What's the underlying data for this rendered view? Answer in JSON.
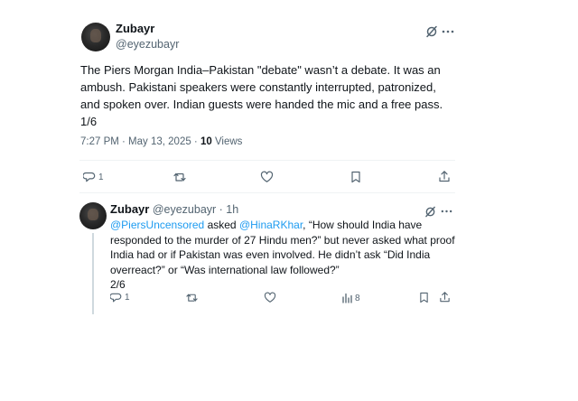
{
  "main_tweet": {
    "author_name": "Zubayr",
    "author_handle": "@eyezubayr",
    "text": "The Piers Morgan India–Pakistan \"debate\" wasn’t a debate. It was an ambush. Pakistani speakers were constantly interrupted, patronized, and spoken over. Indian guests were handed the mic and a free pass.\n1/6",
    "timestamp": "7:27 PM · May 13, 2025 · ",
    "views_count": "10",
    "views_label": " Views",
    "reply_count": "1",
    "icons": [
      "grok-icon",
      "more-icon",
      "reply-icon",
      "retweet-icon",
      "like-icon",
      "bookmark-icon",
      "share-icon"
    ]
  },
  "reply_tweet": {
    "author_name": "Zubayr",
    "author_handle": "@eyezubayr",
    "time_ago": " · 1h",
    "mention_1": "@PiersUncensored",
    "text_1": " asked ",
    "mention_2": "@HinaRKhar",
    "text_2": ", “How should India have responded to the murder of 27 Hindu men?” but never asked what proof India had or if Pakistan was even involved. He didn’t ask “Did India overreact?” or “Was international law followed?”",
    "thread_position": "2/6",
    "reply_count": "1",
    "views_count": "8"
  },
  "colors": {
    "text": "#0f1419",
    "secondary": "#536471",
    "link": "#1d9bf0",
    "divider": "#eff3f4"
  }
}
